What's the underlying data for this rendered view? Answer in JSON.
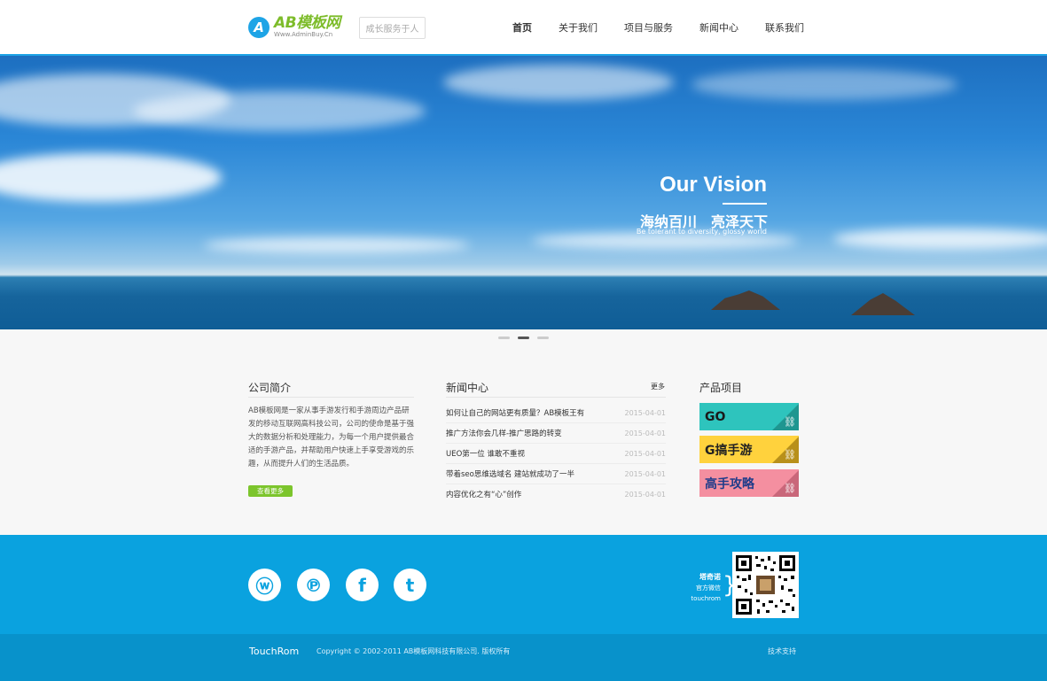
{
  "header": {
    "logo_mark": "A",
    "logo_name": "AB模板网",
    "logo_url": "Www.AdminBuy.Cn",
    "slogan": "成长服务于人",
    "nav": [
      {
        "label": "首页",
        "active": true
      },
      {
        "label": "关于我们",
        "active": false
      },
      {
        "label": "项目与服务",
        "active": false
      },
      {
        "label": "新闻中心",
        "active": false
      },
      {
        "label": "联系我们",
        "active": false
      }
    ]
  },
  "hero": {
    "title": "Our Vision",
    "subtitle_cn": "海纳百川　亮泽天下",
    "subtitle_en": "Be tolerant to diversity, glossy world",
    "active_dot": 1,
    "dot_count": 3
  },
  "about": {
    "title": "公司简介",
    "text": "AB模板网是一家从事手游发行和手游周边产品研发的移动互联网高科技公司，公司的使命是基于强大的数据分析和处理能力，为每一个用户提供最合适的手游产品，并帮助用户快速上手享受游戏的乐趣，从而提升人们的生活品质。",
    "more_label": "查看更多"
  },
  "news": {
    "title": "新闻中心",
    "more_label": "更多",
    "items": [
      {
        "title": "如何让自己的网站更有质量？AB模板王有",
        "date": "2015-04-01"
      },
      {
        "title": "推广方法你会几样-推广思路的转变",
        "date": "2015-04-01"
      },
      {
        "title": "UEO第一位 谁敢不重视",
        "date": "2015-04-01"
      },
      {
        "title": "带着seo思维选域名 建站就成功了一半",
        "date": "2015-04-01"
      },
      {
        "title": "内容优化之有“心”创作",
        "date": "2015-04-01"
      }
    ]
  },
  "products": {
    "title": "产品项目",
    "items": [
      {
        "label": "GO",
        "bg": "#2ec4bd",
        "color": "#1a1a1a",
        "corner": "#1f9690"
      },
      {
        "label": "G搞手游",
        "bg": "#ffd23d",
        "color": "#222",
        "corner": "#b8901a"
      },
      {
        "label": "高手攻略",
        "bg": "#f48fa0",
        "color": "#1f3c8a",
        "corner": "#c9677a"
      }
    ]
  },
  "footer": {
    "social": [
      {
        "icon": "weibo-icon",
        "glyph": "ⓦ"
      },
      {
        "icon": "tencent-weibo-icon",
        "glyph": "℗"
      },
      {
        "icon": "facebook-icon",
        "glyph": "f"
      },
      {
        "icon": "twitter-icon",
        "glyph": "t"
      }
    ],
    "qr_name": "塔奇诺",
    "qr_label": "官方微信",
    "qr_sub": "touchrom",
    "brand": "TouchRom",
    "copyright": "Copyright © 2002-2011 AB模板网科技有限公司. 版权所有",
    "support": "技术支持"
  }
}
